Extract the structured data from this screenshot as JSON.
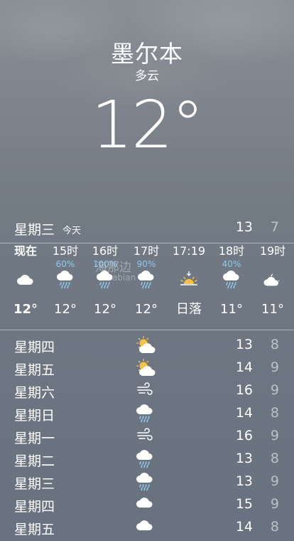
{
  "header": {
    "city": "墨尔本",
    "condition": "多云",
    "temperature": "12°"
  },
  "today": {
    "day": "星期三",
    "tag": "今天",
    "high": "13",
    "low": "7"
  },
  "hourly": [
    {
      "time": "现在",
      "precip": "",
      "icon": "cloud-icon",
      "temp": "12°"
    },
    {
      "time": "15时",
      "precip": "60%",
      "icon": "rain-cloud-icon",
      "temp": "12°"
    },
    {
      "time": "16时",
      "precip": "100%",
      "icon": "rain-cloud-icon",
      "temp": "12°"
    },
    {
      "time": "17时",
      "precip": "90%",
      "icon": "rain-cloud-icon",
      "temp": "12°"
    },
    {
      "time": "17:19",
      "precip": "",
      "icon": "sunset-icon",
      "temp": "日落"
    },
    {
      "time": "18时",
      "precip": "40%",
      "icon": "rain-cloud-icon",
      "temp": "11°"
    },
    {
      "time": "19时",
      "precip": "",
      "icon": "cloud-moon-icon",
      "temp": "11°"
    }
  ],
  "daily": [
    {
      "day": "星期四",
      "icon": "partly-sunny-icon",
      "high": "13",
      "low": "8"
    },
    {
      "day": "星期五",
      "icon": "partly-sunny-icon",
      "high": "14",
      "low": "9"
    },
    {
      "day": "星期六",
      "icon": "wind-icon",
      "high": "16",
      "low": "9"
    },
    {
      "day": "星期日",
      "icon": "rain-cloud-icon",
      "high": "14",
      "low": "8"
    },
    {
      "day": "星期一",
      "icon": "wind-icon",
      "high": "16",
      "low": "9"
    },
    {
      "day": "星期二",
      "icon": "rain-cloud-icon",
      "high": "13",
      "low": "8"
    },
    {
      "day": "星期三",
      "icon": "rain-cloud-icon",
      "high": "13",
      "low": "9"
    },
    {
      "day": "星期四",
      "icon": "cloud-icon",
      "high": "15",
      "low": "9"
    },
    {
      "day": "星期五",
      "icon": "cloud-icon",
      "high": "14",
      "low": "8"
    }
  ],
  "watermark": {
    "text": "海那边",
    "subtext": "Hinabian"
  },
  "colors": {
    "precip": "#8ccaf0",
    "sun": "#f5c242"
  }
}
